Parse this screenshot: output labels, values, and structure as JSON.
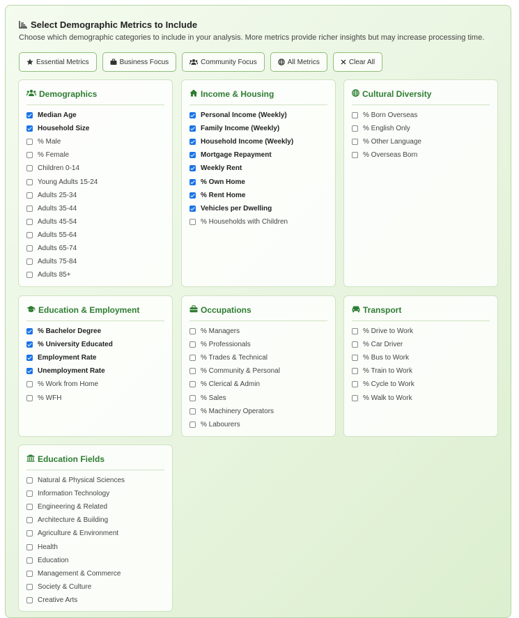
{
  "header": {
    "title": "Select Demographic Metrics to Include",
    "subtitle": "Choose which demographic categories to include in your analysis. More metrics provide richer insights but may increase processing time."
  },
  "buttons": [
    {
      "label": "Essential Metrics",
      "icon": "star-icon"
    },
    {
      "label": "Business Focus",
      "icon": "briefcase-icon"
    },
    {
      "label": "Community Focus",
      "icon": "users-icon"
    },
    {
      "label": "All Metrics",
      "icon": "globe-icon"
    },
    {
      "label": "Clear All",
      "icon": "close-icon"
    }
  ],
  "colors": {
    "accent": "#2e7d32",
    "checkbox": "#1a73e8",
    "border": "#8fbf7a"
  },
  "cards": [
    {
      "title": "Demographics",
      "icon": "users-icon",
      "items": [
        {
          "label": "Median Age",
          "checked": true
        },
        {
          "label": "Household Size",
          "checked": true
        },
        {
          "label": "% Male",
          "checked": false
        },
        {
          "label": "% Female",
          "checked": false
        },
        {
          "label": "Children 0-14",
          "checked": false
        },
        {
          "label": "Young Adults 15-24",
          "checked": false
        },
        {
          "label": "Adults 25-34",
          "checked": false
        },
        {
          "label": "Adults 35-44",
          "checked": false
        },
        {
          "label": "Adults 45-54",
          "checked": false
        },
        {
          "label": "Adults 55-64",
          "checked": false
        },
        {
          "label": "Adults 65-74",
          "checked": false
        },
        {
          "label": "Adults 75-84",
          "checked": false
        },
        {
          "label": "Adults 85+",
          "checked": false
        }
      ]
    },
    {
      "title": "Income & Housing",
      "icon": "home-icon",
      "items": [
        {
          "label": "Personal Income (Weekly)",
          "checked": true
        },
        {
          "label": "Family Income (Weekly)",
          "checked": true
        },
        {
          "label": "Household Income (Weekly)",
          "checked": true
        },
        {
          "label": "Mortgage Repayment",
          "checked": true
        },
        {
          "label": "Weekly Rent",
          "checked": true
        },
        {
          "label": "% Own Home",
          "checked": true
        },
        {
          "label": "% Rent Home",
          "checked": true
        },
        {
          "label": "Vehicles per Dwelling",
          "checked": true
        },
        {
          "label": "% Households with Children",
          "checked": false
        }
      ]
    },
    {
      "title": "Cultural Diversity",
      "icon": "globe-icon",
      "items": [
        {
          "label": "% Born Overseas",
          "checked": false
        },
        {
          "label": "% English Only",
          "checked": false
        },
        {
          "label": "% Other Language",
          "checked": false
        },
        {
          "label": "% Overseas Born",
          "checked": false
        }
      ]
    },
    {
      "title": "Education & Employment",
      "icon": "graduation-cap-icon",
      "items": [
        {
          "label": "% Bachelor Degree",
          "checked": true
        },
        {
          "label": "% University Educated",
          "checked": true
        },
        {
          "label": "Employment Rate",
          "checked": true
        },
        {
          "label": "Unemployment Rate",
          "checked": true
        },
        {
          "label": "% Work from Home",
          "checked": false
        },
        {
          "label": "% WFH",
          "checked": false
        }
      ]
    },
    {
      "title": "Occupations",
      "icon": "briefcase-icon",
      "items": [
        {
          "label": "% Managers",
          "checked": false
        },
        {
          "label": "% Professionals",
          "checked": false
        },
        {
          "label": "% Trades & Technical",
          "checked": false
        },
        {
          "label": "% Community & Personal",
          "checked": false
        },
        {
          "label": "% Clerical & Admin",
          "checked": false
        },
        {
          "label": "% Sales",
          "checked": false
        },
        {
          "label": "% Machinery Operators",
          "checked": false
        },
        {
          "label": "% Labourers",
          "checked": false
        }
      ]
    },
    {
      "title": "Transport",
      "icon": "car-icon",
      "items": [
        {
          "label": "% Drive to Work",
          "checked": false
        },
        {
          "label": "% Car Driver",
          "checked": false
        },
        {
          "label": "% Bus to Work",
          "checked": false
        },
        {
          "label": "% Train to Work",
          "checked": false
        },
        {
          "label": "% Cycle to Work",
          "checked": false
        },
        {
          "label": "% Walk to Work",
          "checked": false
        }
      ]
    },
    {
      "title": "Education Fields",
      "icon": "university-icon",
      "items": [
        {
          "label": "Natural & Physical Sciences",
          "checked": false
        },
        {
          "label": "Information Technology",
          "checked": false
        },
        {
          "label": "Engineering & Related",
          "checked": false
        },
        {
          "label": "Architecture & Building",
          "checked": false
        },
        {
          "label": "Agriculture & Environment",
          "checked": false
        },
        {
          "label": "Health",
          "checked": false
        },
        {
          "label": "Education",
          "checked": false
        },
        {
          "label": "Management & Commerce",
          "checked": false
        },
        {
          "label": "Society & Culture",
          "checked": false
        },
        {
          "label": "Creative Arts",
          "checked": false
        }
      ]
    }
  ]
}
